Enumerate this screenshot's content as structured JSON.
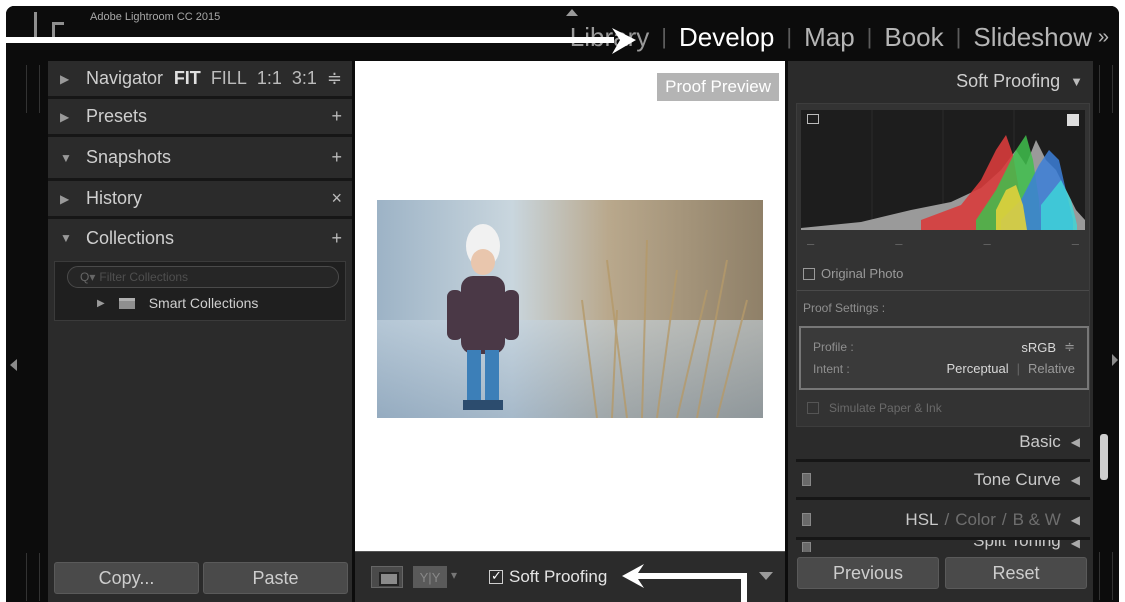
{
  "app": {
    "title": "Adobe Lightroom CC 2015",
    "logo": "Lr"
  },
  "modules": [
    "Library",
    "Develop",
    "Map",
    "Book",
    "Slideshow"
  ],
  "modules_more": "»",
  "left_panel": {
    "navigator": {
      "label": "Navigator",
      "options": [
        "FIT",
        "FILL",
        "1:1",
        "3:1"
      ],
      "stepper": "≑"
    },
    "presets": {
      "label": "Presets",
      "action": "+"
    },
    "snapshots": {
      "label": "Snapshots",
      "action": "+"
    },
    "history": {
      "label": "History",
      "action": "×"
    },
    "collections": {
      "label": "Collections",
      "action": "+",
      "filter_placeholder": "Filter Collections",
      "items": [
        "Smart Collections"
      ]
    }
  },
  "left_buttons": {
    "copy": "Copy...",
    "paste": "Paste"
  },
  "center": {
    "proof_label": "Proof Preview"
  },
  "toolbar": {
    "yy": "Y|Y",
    "soft_proofing": "Soft Proofing"
  },
  "right_panel": {
    "header": "Soft Proofing",
    "histogram_markers": [
      "–",
      "–",
      "–",
      "–"
    ],
    "original_photo": "Original Photo",
    "proof_settings": "Proof Settings :",
    "profile_label": "Profile :",
    "profile_value": "sRGB",
    "intent_label": "Intent :",
    "intent_options": [
      "Perceptual",
      "Relative"
    ],
    "simulate": "Simulate Paper & Ink",
    "sections": {
      "basic": "Basic",
      "tone_curve": "Tone Curve",
      "hsl": "HSL",
      "color": "Color",
      "bw": "B & W",
      "split": "Split Toning"
    }
  },
  "right_buttons": {
    "previous": "Previous",
    "reset": "Reset"
  },
  "colors": {
    "panel": "#2b2b2b",
    "background": "#0c0c0c",
    "accent": "#ffffff"
  }
}
